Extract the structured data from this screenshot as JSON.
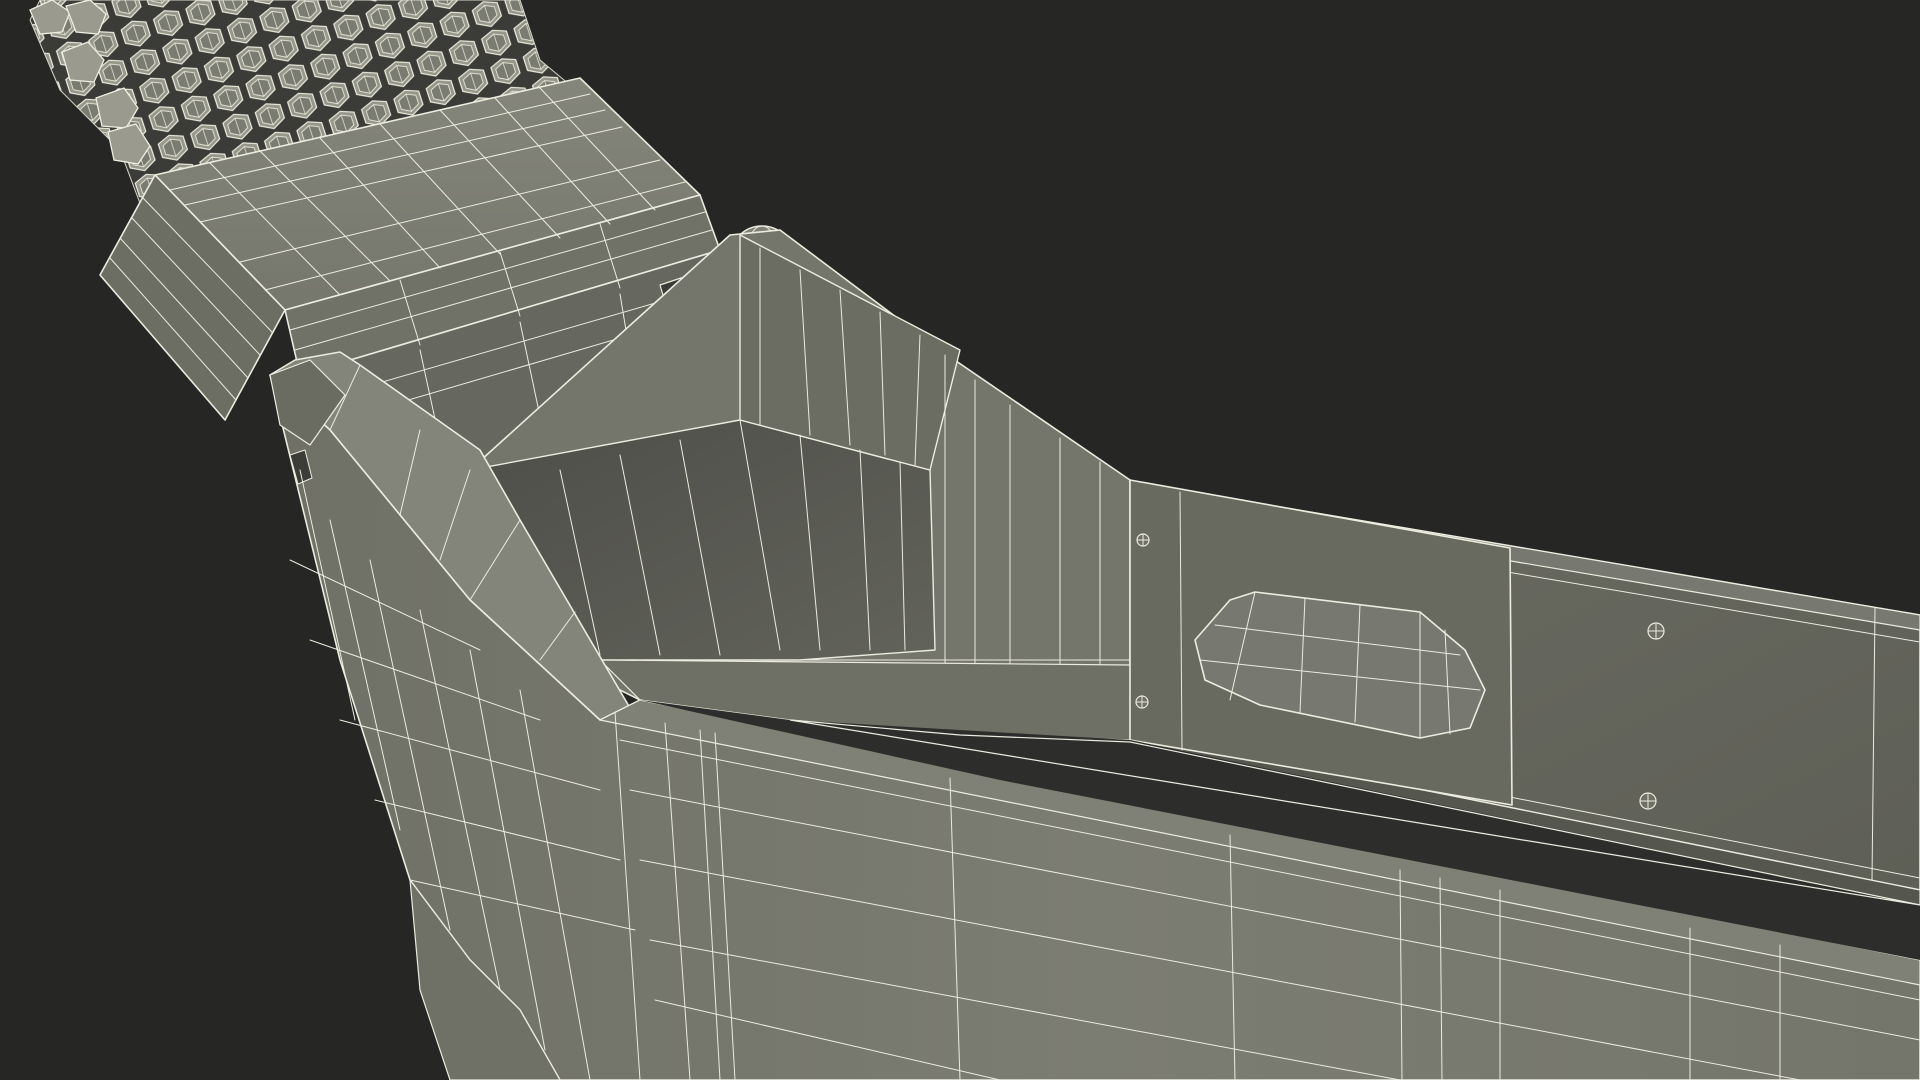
{
  "scene": {
    "subject": "wireframe-3d-model",
    "colors": {
      "background": "#262625",
      "surface_light": "#7a7b70",
      "surface_mid": "#6d6e64",
      "surface_dark": "#4f504a",
      "surface_shadow": "#3f403b",
      "wire": "#e9e8da"
    },
    "icons": [
      "screw-icon",
      "screw-icon",
      "screw-icon",
      "screw-icon"
    ]
  }
}
